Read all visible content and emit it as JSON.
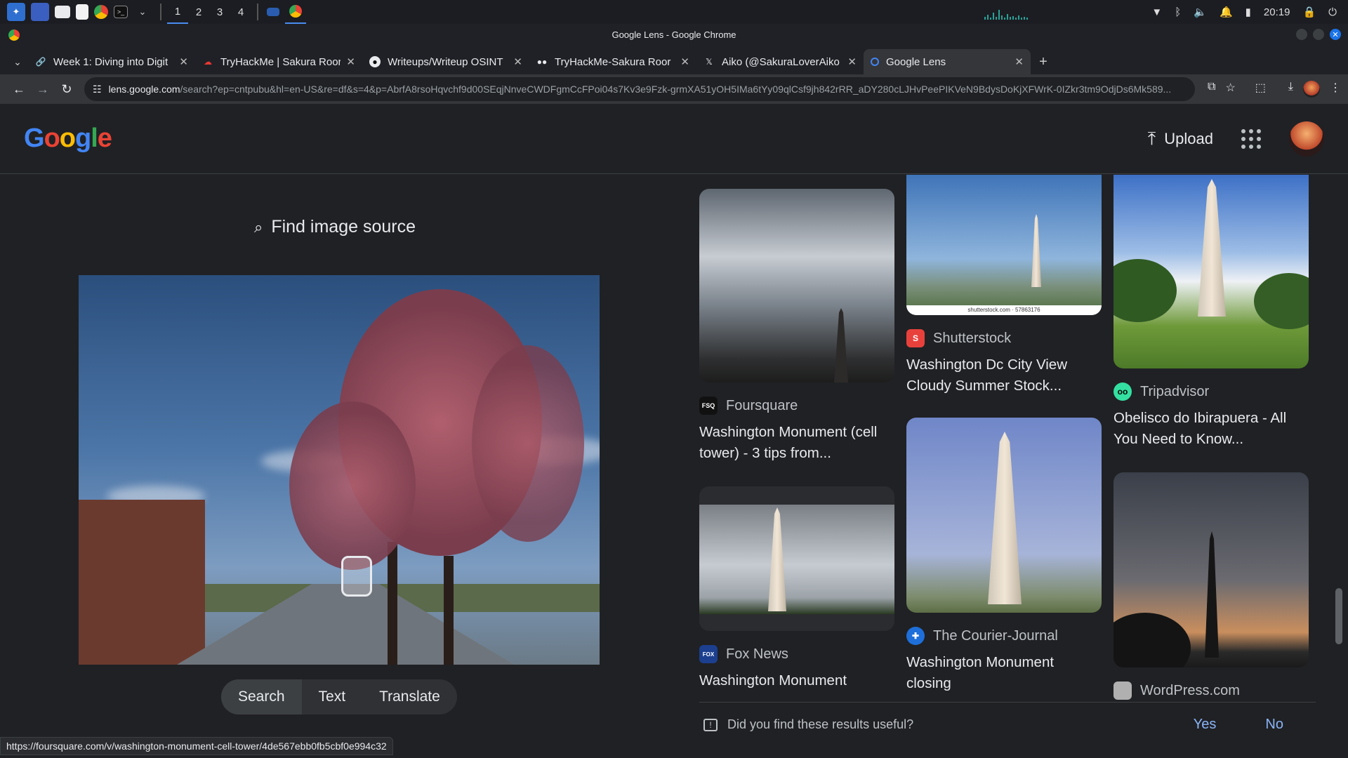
{
  "taskbar": {
    "workspaces": [
      "1",
      "2",
      "3",
      "4"
    ],
    "active_workspace": "1",
    "clock": "20:19"
  },
  "window": {
    "title": "Google Lens - Google Chrome"
  },
  "tabs": [
    {
      "label": "Week 1: Diving into Digit",
      "icon": "link-icon",
      "active": false
    },
    {
      "label": "TryHackMe | Sakura Roor",
      "icon": "tryhackme-icon",
      "active": false
    },
    {
      "label": "Writeups/Writeup OSINT",
      "icon": "github-icon",
      "active": false
    },
    {
      "label": "TryHackMe-Sakura Roor",
      "icon": "medium-icon",
      "active": false
    },
    {
      "label": "Aiko (@SakuraLoverAiko",
      "icon": "x-icon",
      "active": false
    },
    {
      "label": "Google Lens",
      "icon": "google-lens-icon",
      "active": true
    }
  ],
  "address_bar": {
    "host": "lens.google.com",
    "path": "/search?ep=cntpubu&hl=en-US&re=df&s=4&p=AbrfA8rsoHqvchf9d00SEqjNnveCWDFgmCcFPoi04s7Kv3e9Fzk-grmXA51yOH5IMa6tYy09qlCsf9jh842rRR_aDY280cLJHvPeePIKVeN9BdysDoKjXFWrK-0IZkr3tm9OdjDs6Mk589..."
  },
  "lens": {
    "logo": [
      "G",
      "o",
      "o",
      "g",
      "l",
      "e"
    ],
    "upload_label": "Upload",
    "find_source_label": "Find image source",
    "modes": [
      "Search",
      "Text",
      "Translate"
    ],
    "active_mode": "Search"
  },
  "results": [
    {
      "source": "Foursquare",
      "title": "Washington Monument (cell tower) - 3 tips from...",
      "icon_color": "#111111"
    },
    {
      "source": "Fox News",
      "title": "Washington Monument Remains Closed Aft...",
      "icon_color": "#1c3f8f"
    },
    {
      "source": "Shutterstock",
      "title": "Washington Dc City View Cloudy Summer Stock...",
      "icon_color": "#e8413c",
      "watermark": "shutterstock.com · 57863176"
    },
    {
      "source": "The Courier-Journal",
      "title": "Washington Monument closing",
      "icon_color": "#1e6fd9"
    },
    {
      "source": "Tripadvisor",
      "title": "Obelisco do Ibirapuera - All You Need to Know...",
      "icon_color": "#34e0a1"
    },
    {
      "source": "WordPress.com",
      "title": "",
      "icon_color": "#b0b0b0"
    }
  ],
  "feedback": {
    "question": "Did you find these results useful?",
    "yes": "Yes",
    "no": "No"
  },
  "status_url": "https://foursquare.com/v/washington-monument-cell-tower/4de567ebb0fb5cbf0e994c32"
}
